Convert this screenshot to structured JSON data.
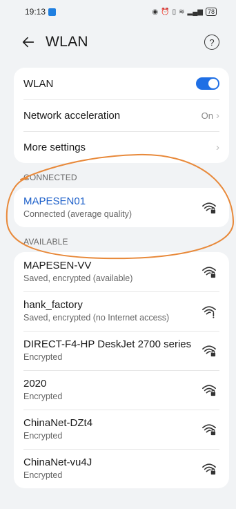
{
  "status_bar": {
    "time": "19:13",
    "right_icons": [
      "eye-icon",
      "alarm-icon",
      "vibrate-icon",
      "wifi-signal-icon",
      "cell-signal-icon"
    ],
    "battery": "78"
  },
  "header": {
    "title": "WLAN"
  },
  "settings": {
    "wlan_label": "WLAN",
    "wlan_enabled": true,
    "acceleration_label": "Network acceleration",
    "acceleration_value": "On",
    "more_label": "More settings"
  },
  "connected": {
    "section_label": "CONNECTED",
    "network": {
      "name": "MAPESEN01",
      "status": "Connected (average quality)",
      "icon": "wifi-locked-icon"
    }
  },
  "available": {
    "section_label": "AVAILABLE",
    "networks": [
      {
        "name": "MAPESEN-VV",
        "status": "Saved, encrypted (available)",
        "icon": "wifi-locked-icon"
      },
      {
        "name": "hank_factory",
        "status": "Saved, encrypted (no Internet access)",
        "icon": "wifi-no-internet-icon"
      },
      {
        "name": "DIRECT-F4-HP DeskJet 2700 series",
        "status": "Encrypted",
        "icon": "wifi-locked-icon"
      },
      {
        "name": "2020",
        "status": "Encrypted",
        "icon": "wifi-locked-icon"
      },
      {
        "name": "ChinaNet-DZt4",
        "status": "Encrypted",
        "icon": "wifi-locked-icon"
      },
      {
        "name": "ChinaNet-vu4J",
        "status": "Encrypted",
        "icon": "wifi-locked-icon"
      }
    ]
  },
  "colors": {
    "accent": "#1f6fe5",
    "annotation": "#e8893a"
  }
}
